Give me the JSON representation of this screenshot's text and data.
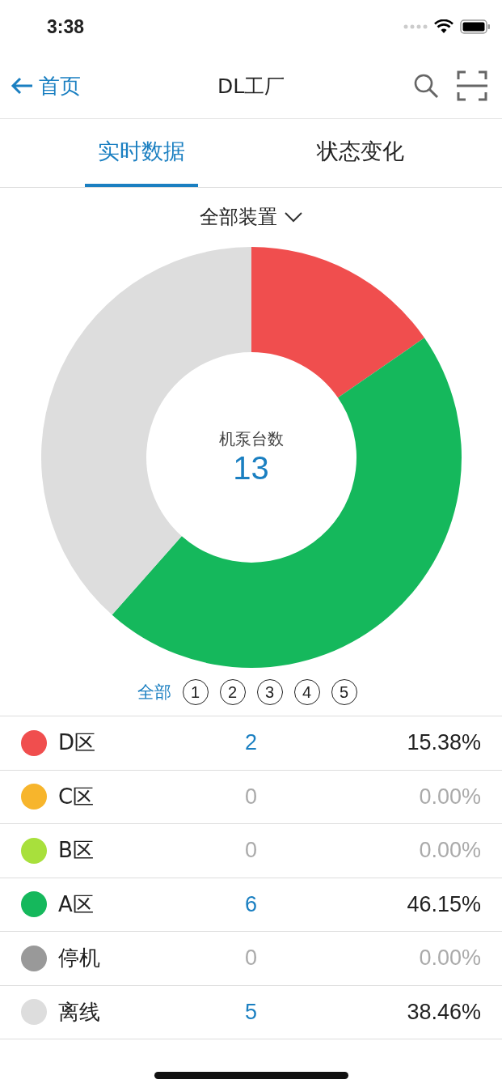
{
  "status_bar": {
    "time": "3:38"
  },
  "nav": {
    "back_label": "首页",
    "title": "DL工厂"
  },
  "tabs": [
    {
      "label": "实时数据",
      "selected": true
    },
    {
      "label": "状态变化",
      "selected": false
    }
  ],
  "device_filter": {
    "label": "全部装置"
  },
  "chart": {
    "center_label": "机泵台数",
    "center_value": "13"
  },
  "zone_filters": [
    {
      "label": "全部",
      "selected": true
    },
    {
      "label": "1",
      "selected": false
    },
    {
      "label": "2",
      "selected": false
    },
    {
      "label": "3",
      "selected": false
    },
    {
      "label": "4",
      "selected": false
    },
    {
      "label": "5",
      "selected": false
    }
  ],
  "rows": [
    {
      "name": "D区",
      "color": "#f04e4e",
      "count": "2",
      "percent": "15.38%"
    },
    {
      "name": "C区",
      "color": "#f7b52c",
      "count": "0",
      "percent": "0.00%"
    },
    {
      "name": "B区",
      "color": "#a8e03c",
      "count": "0",
      "percent": "0.00%"
    },
    {
      "name": "A区",
      "color": "#15b85c",
      "count": "6",
      "percent": "46.15%"
    },
    {
      "name": "停机",
      "color": "#999999",
      "count": "0",
      "percent": "0.00%"
    },
    {
      "name": "离线",
      "color": "#dddddd",
      "count": "5",
      "percent": "38.46%"
    }
  ]
}
